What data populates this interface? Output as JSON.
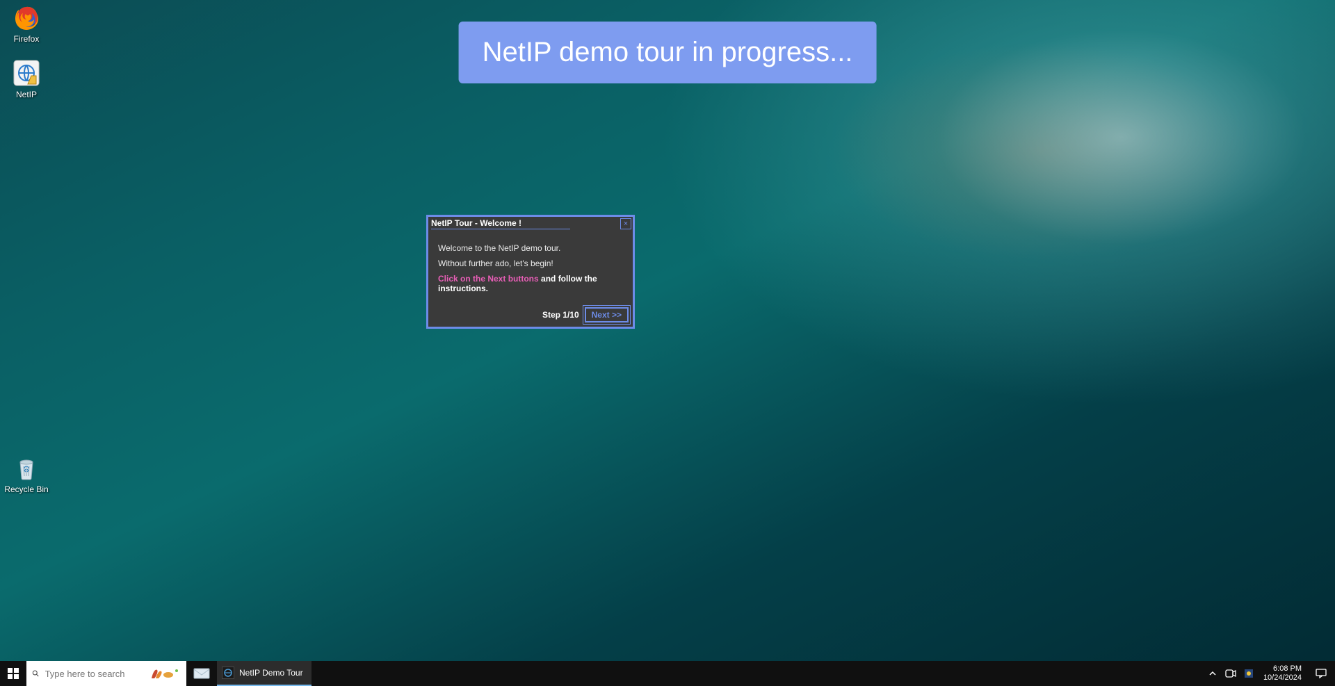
{
  "desktop": {
    "icons": {
      "firefox": "Firefox",
      "netip": "NetIP",
      "recycle": "Recycle Bin"
    }
  },
  "banner": {
    "text": "NetIP demo tour in progress..."
  },
  "tour": {
    "title": "NetIP Tour - Welcome !",
    "welcome_line": "Welcome to the NetIP demo tour.",
    "begin_line": "Without further ado, let's begin!",
    "instruction_highlight": "Click on the Next buttons",
    "instruction_rest": " and follow the instructions.",
    "step_label": "Step 1/10",
    "next_label": "Next >>",
    "close_glyph": "×"
  },
  "taskbar": {
    "search_placeholder": "Type here to search",
    "active_app": "NetIP Demo Tour",
    "clock": {
      "time": "6:08 PM",
      "date": "10/24/2024"
    }
  }
}
